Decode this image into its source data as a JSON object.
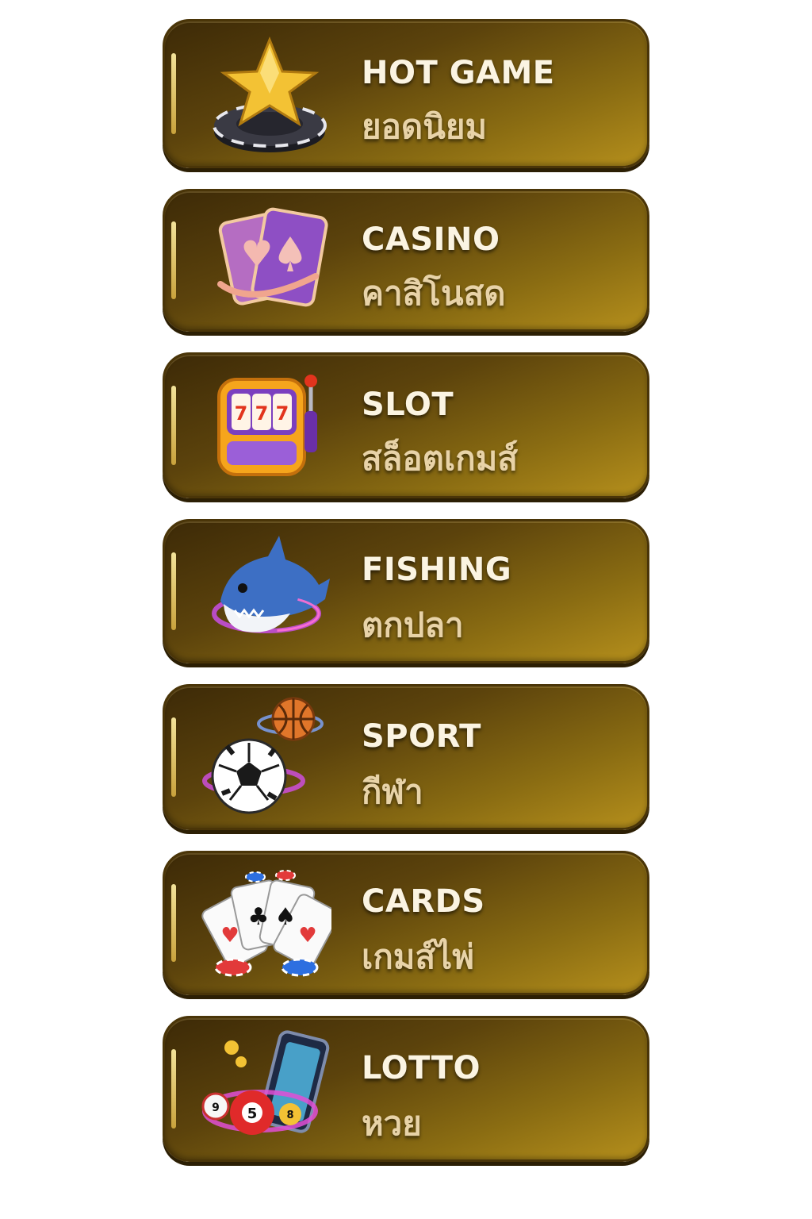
{
  "menu": {
    "items": [
      {
        "title": "HOT GAME",
        "subtitle": "ยอดนิยม",
        "icon": "star-chip-icon"
      },
      {
        "title": "CASINO",
        "subtitle": "คาสิโนสด",
        "icon": "playing-cards-icon"
      },
      {
        "title": "SLOT",
        "subtitle": "สล็อตเกมส์",
        "icon": "slot-machine-icon"
      },
      {
        "title": "FISHING",
        "subtitle": "ตกปลา",
        "icon": "shark-icon"
      },
      {
        "title": "SPORT",
        "subtitle": "กีฬา",
        "icon": "soccer-basketball-icon"
      },
      {
        "title": "CARDS",
        "subtitle": "เกมส์ไพ่",
        "icon": "cards-chips-icon"
      },
      {
        "title": "LOTTO",
        "subtitle": "หวย",
        "icon": "lottery-balls-icon"
      }
    ]
  },
  "colors": {
    "button_dark": "#3d2a07",
    "button_light": "#b58f1c",
    "title_text": "#fbf4e2",
    "subtitle_text": "#e8d3a8"
  }
}
